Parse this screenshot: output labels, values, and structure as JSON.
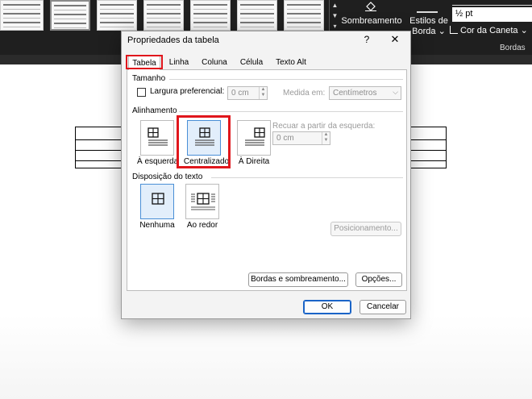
{
  "ribbon": {
    "shading_label": "Sombreamento",
    "border_styles_label": "Estilos de Borda",
    "border_styles_chevron": "⌄",
    "pen_weight": "½ pt",
    "pen_color_label": "Cor da Caneta",
    "pen_color_chevron": "⌄",
    "group_label": "Bordas"
  },
  "dialog": {
    "title": "Propriedades da tabela",
    "help": "?",
    "close": "✕",
    "tabs": [
      {
        "label": "Tabela",
        "active": true
      },
      {
        "label": "Linha"
      },
      {
        "label": "Coluna"
      },
      {
        "label": "Célula"
      },
      {
        "label": "Texto Alt"
      }
    ],
    "size": {
      "section_label": "Tamanho",
      "preferred_width_label": "Largura preferencial:",
      "preferred_width_checked": false,
      "preferred_width_value": "0 cm",
      "measure_in_label": "Medida em:",
      "measure_in_value": "Centímetros"
    },
    "alignment": {
      "section_label": "Alinhamento",
      "options": [
        {
          "label": "À esquerda",
          "selected": false
        },
        {
          "label": "Centralizado",
          "selected": true
        },
        {
          "label": "À Direita",
          "selected": false
        }
      ],
      "indent_label": "Recuar a partir da esquerda:",
      "indent_value": "0 cm"
    },
    "text_wrapping": {
      "section_label": "Disposição do texto",
      "options": [
        {
          "label": "Nenhuma",
          "selected": true
        },
        {
          "label": "Ao redor",
          "selected": false
        }
      ],
      "positioning_button": "Posicionamento..."
    },
    "borders_button": "Bordas e sombreamento...",
    "options_button": "Opções...",
    "ok_button": "OK",
    "cancel_button": "Cancelar"
  },
  "colors": {
    "highlight": "#e0161c",
    "selected_tile_bg": "#e2eefb",
    "selected_tile_border": "#4a8fd6",
    "default_button_border": "#1a64c7"
  }
}
